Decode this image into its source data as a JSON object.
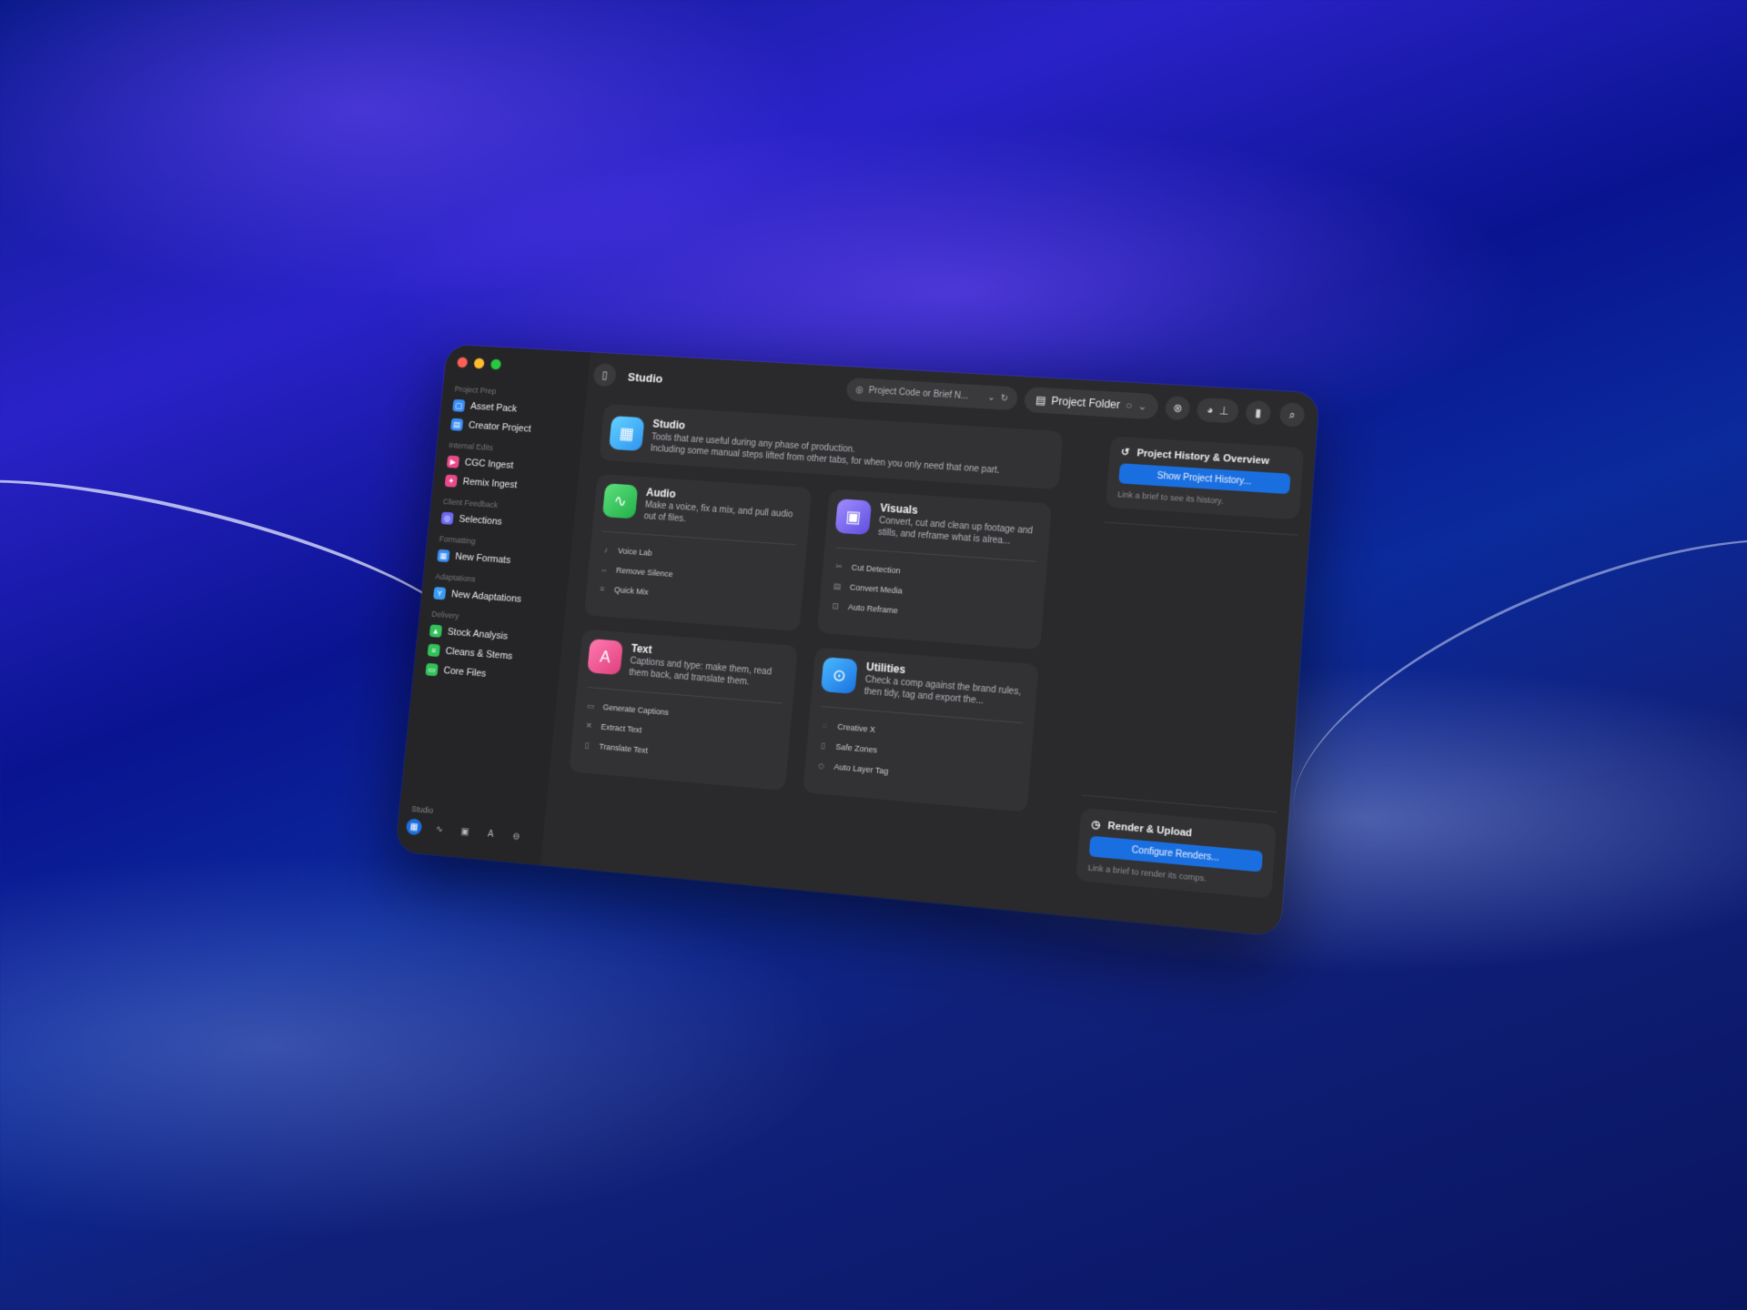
{
  "sidebar": {
    "sections": [
      {
        "title": "Project Prep",
        "items": [
          {
            "label": "Asset Pack",
            "icon": "box-icon",
            "color": "#3a8df5"
          },
          {
            "label": "Creator Project",
            "icon": "folder-icon",
            "color": "#3a8df5"
          }
        ]
      },
      {
        "title": "Internal Edits",
        "items": [
          {
            "label": "CGC Ingest",
            "icon": "video-icon",
            "color": "#e84a8a"
          },
          {
            "label": "Remix Ingest",
            "icon": "wand-icon",
            "color": "#e84a8a"
          }
        ]
      },
      {
        "title": "Client Feedback",
        "items": [
          {
            "label": "Selections",
            "icon": "selection-icon",
            "color": "#6a6af5"
          }
        ]
      },
      {
        "title": "Formatting",
        "items": [
          {
            "label": "New Formats",
            "icon": "layout-icon",
            "color": "#3a8df5"
          }
        ]
      },
      {
        "title": "Adaptations",
        "items": [
          {
            "label": "New Adaptations",
            "icon": "branch-icon",
            "color": "#3a9bf5"
          }
        ]
      },
      {
        "title": "Delivery",
        "items": [
          {
            "label": "Stock Analysis",
            "icon": "chart-icon",
            "color": "#33c15a"
          },
          {
            "label": "Cleans & Stems",
            "icon": "layers-icon",
            "color": "#33c15a"
          },
          {
            "label": "Core Files",
            "icon": "file-icon",
            "color": "#33c15a"
          }
        ]
      }
    ],
    "footer_label": "Studio"
  },
  "toolbar": {
    "title": "Studio",
    "brief_placeholder": "Project Code or Brief N...",
    "folder_label": "Project Folder"
  },
  "studio": {
    "title": "Studio",
    "description": "Tools that are useful during any phase of production.\nIncluding some manual steps lifted from other tabs, for when you only need that one part."
  },
  "cards": {
    "audio": {
      "title": "Audio",
      "description": "Make a voice, fix a mix, and pull audio out of files.",
      "tools": [
        "Voice Lab",
        "Remove Silence",
        "Quick Mix"
      ]
    },
    "visuals": {
      "title": "Visuals",
      "description": "Convert, cut and clean up footage and stills, and reframe what is alrea...",
      "tools": [
        "Cut Detection",
        "Convert Media",
        "Auto Reframe"
      ]
    },
    "text": {
      "title": "Text",
      "description": "Captions and type: make them, read them back, and translate them.",
      "tools": [
        "Generate Captions",
        "Extract Text",
        "Translate Text"
      ]
    },
    "utilities": {
      "title": "Utilities",
      "description": "Check a comp against the brand rules, then tidy, tag and export the...",
      "tools": [
        "Creative X",
        "Safe Zones",
        "Auto Layer Tag"
      ]
    }
  },
  "history_panel": {
    "title": "Project History & Overview",
    "button_label": "Show Project History...",
    "note": "Link a brief to see its history."
  },
  "render_panel": {
    "title": "Render & Upload",
    "button_label": "Configure Renders...",
    "note": "Link a brief to render its comps."
  }
}
